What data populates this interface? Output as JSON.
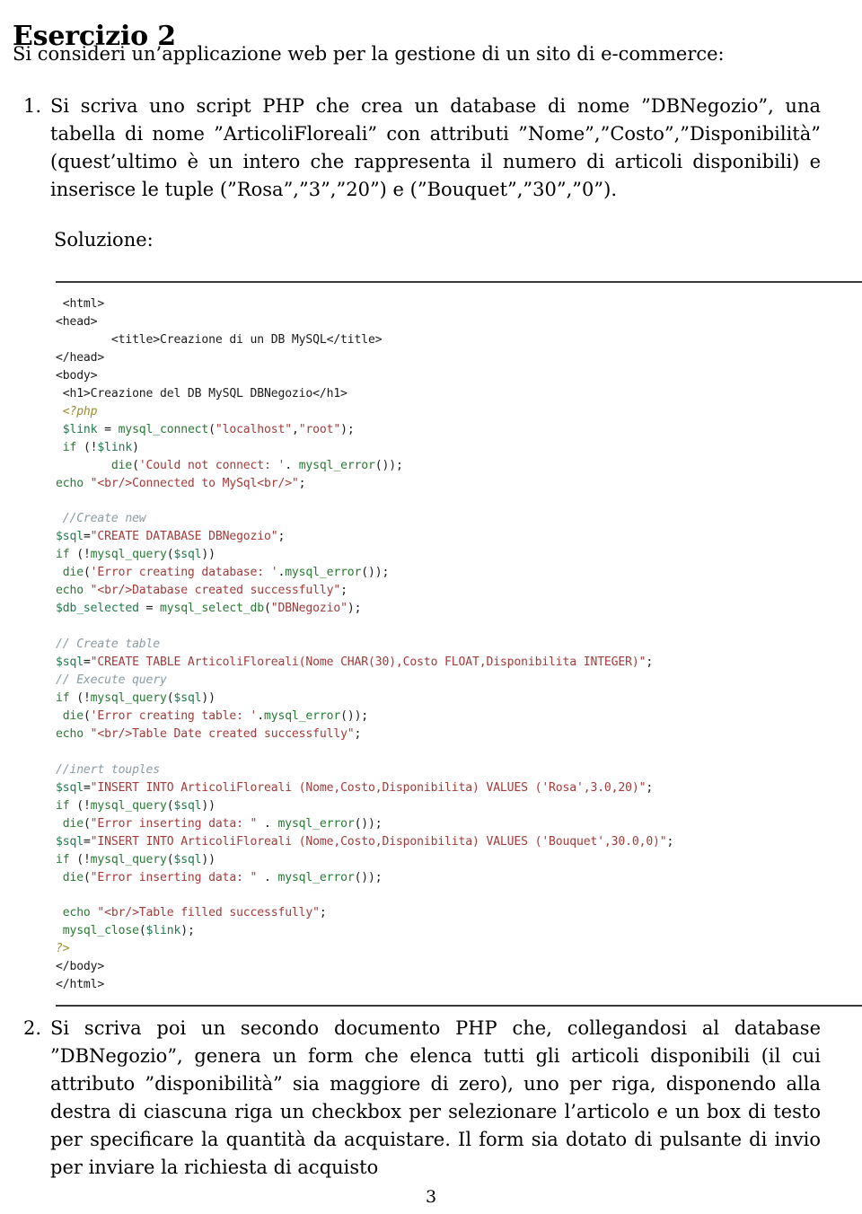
{
  "document": {
    "title": "Esercizio 2",
    "intro": "Si consideri un’applicazione web per la gestione di un sito di e-commerce:",
    "soluzione_label": "Soluzione:",
    "page_number": "3"
  },
  "items": [
    {
      "number": "1.",
      "text": "Si scriva uno script PHP che crea un database di nome ”DBNegozio”, una tabella di nome ”ArticoliFloreali” con attributi ”Nome”,”Costo”,”Disponibilità” (quest’ultimo è un intero che rappresenta il numero di articoli disponibili) e inserisce le tuple (”Rosa”,”3”,”20”) e (”Bouquet”,”30”,”0”)."
    },
    {
      "number": "2.",
      "text": "Si scriva poi un secondo documento PHP che, collegandosi al database ”DBNegozio”, genera un form che elenca tutti gli articoli disponibili (il cui attributo ”disponibilità” sia maggiore di zero), uno per riga, disponendo alla destra di ciascuna riga un checkbox per selezionare l’articolo e un box di testo per specificare la quantità da acquistare. Il form sia dotato di pulsante di invio per inviare la richiesta di acquisto"
    }
  ],
  "code": {
    "language": "php",
    "lines": [
      " <html>",
      "<head>",
      "        <title>Creazione di un DB MySQL</title>",
      "</head>",
      "<body>",
      " <h1>Creazione del DB MySQL DBNegozio</h1>",
      " <?php",
      " $link = mysql_connect(\"localhost\",\"root\");",
      " if (!$link)",
      "        die('Could not connect: '. mysql_error());",
      "echo \"<br/>Connected to MySql<br/>\";",
      "",
      " //Create new",
      "$sql=\"CREATE DATABASE DBNegozio\";",
      "if (!mysql_query($sql))",
      " die('Error creating database: '.mysql_error());",
      "echo \"<br/>Database created successfully\";",
      "$db_selected = mysql_select_db(\"DBNegozio\");",
      "",
      "// Create table",
      "$sql=\"CREATE TABLE ArticoliFloreali(Nome CHAR(30),Costo FLOAT,Disponibilita INTEGER)\";",
      "// Execute query",
      "if (!mysql_query($sql))",
      " die('Error creating table: '.mysql_error());",
      "echo \"<br/>Table Date created successfully\";",
      "",
      "//inert touples",
      "$sql=\"INSERT INTO ArticoliFloreali (Nome,Costo,Disponibilita) VALUES ('Rosa',3.0,20)\";",
      "if (!mysql_query($sql))",
      " die(\"Error inserting data: \" . mysql_error());",
      "$sql=\"INSERT INTO ArticoliFloreali (Nome,Costo,Disponibilita) VALUES ('Bouquet',30.0,0)\";",
      "if (!mysql_query($sql))",
      " die(\"Error inserting data: \" . mysql_error());",
      "",
      " echo \"<br/>Table filled successfully\";",
      " mysql_close($link);",
      "?>",
      "</body>",
      "</html>"
    ]
  },
  "colors": {
    "string": "#a33a3a",
    "keyword": "#267a33",
    "variable": "#1f7a4d",
    "comment": "#8a9aa3",
    "php_delimiter": "#9a8b2e",
    "text": "#1a1a1a",
    "rule": "#3a3a3a"
  }
}
